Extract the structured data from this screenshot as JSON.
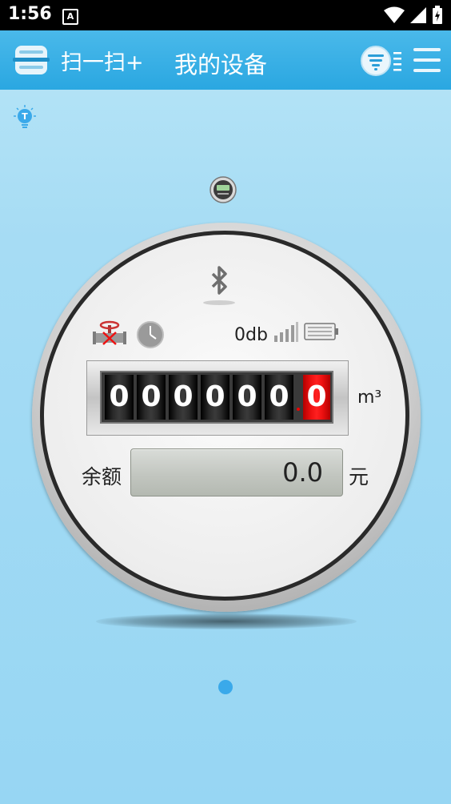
{
  "status_bar": {
    "time": "1:56",
    "notification_letter": "A"
  },
  "header": {
    "scan_label": "扫一扫+",
    "title": "我的设备"
  },
  "meter": {
    "signal_text": "0db",
    "digits": [
      "0",
      "0",
      "0",
      "0",
      "0",
      "0"
    ],
    "decimal_digit": "0",
    "unit": "m³",
    "balance_label": "余额",
    "balance_value": "0.0",
    "currency": "元"
  },
  "pager": {
    "current_page": 1,
    "page_count": 1
  },
  "icons": {
    "tip": "lightbulb-icon",
    "device": "meter-device-icon",
    "bluetooth": "bluetooth-icon",
    "valve": "valve-closed-icon",
    "clock": "clock-icon",
    "signal": "signal-bars-icon",
    "battery": "battery-icon",
    "filter": "filter-list-icon",
    "menu": "hamburger-menu-icon",
    "scan": "scan-icon"
  },
  "colors": {
    "header": "#2aa7e1",
    "background": "#a6dcf4",
    "decimal_digit_bg": "#ee1111",
    "page_dot": "#3aa9ea"
  }
}
